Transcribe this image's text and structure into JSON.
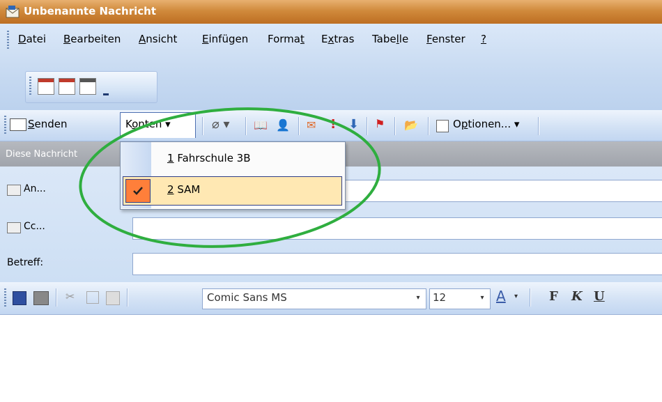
{
  "window": {
    "title": "Unbenannte Nachricht"
  },
  "menubar": {
    "items": [
      {
        "label": "Datei"
      },
      {
        "label": "Bearbeiten"
      },
      {
        "label": "Ansicht"
      },
      {
        "label": "Einfügen"
      },
      {
        "label": "Format"
      },
      {
        "label": "Extras"
      },
      {
        "label": "Tabelle"
      },
      {
        "label": "Fenster"
      },
      {
        "label": "?"
      }
    ]
  },
  "toolbar": {
    "send_label": "Senden",
    "accounts_label": "Konten",
    "options_label": "Optionen..."
  },
  "accounts_menu": {
    "items": [
      {
        "number": "1",
        "label": "Fahrschule 3B",
        "checked": false
      },
      {
        "number": "2",
        "label": "SAM",
        "checked": true
      }
    ]
  },
  "header": {
    "info_text": "Diese Nachricht",
    "to_label": "An...",
    "cc_label": "Cc...",
    "subject_label": "Betreff:"
  },
  "format_toolbar": {
    "font_name": "Comic Sans MS",
    "font_size": "12",
    "font_color_glyph": "A",
    "bold_glyph": "F",
    "italic_glyph": "K",
    "underline_glyph": "U"
  },
  "colors": {
    "titlebar": "#d08a3c",
    "menu_highlight": "#ffe8b3",
    "check_bg": "#ff7f3a",
    "annotation": "#2fae3f"
  }
}
